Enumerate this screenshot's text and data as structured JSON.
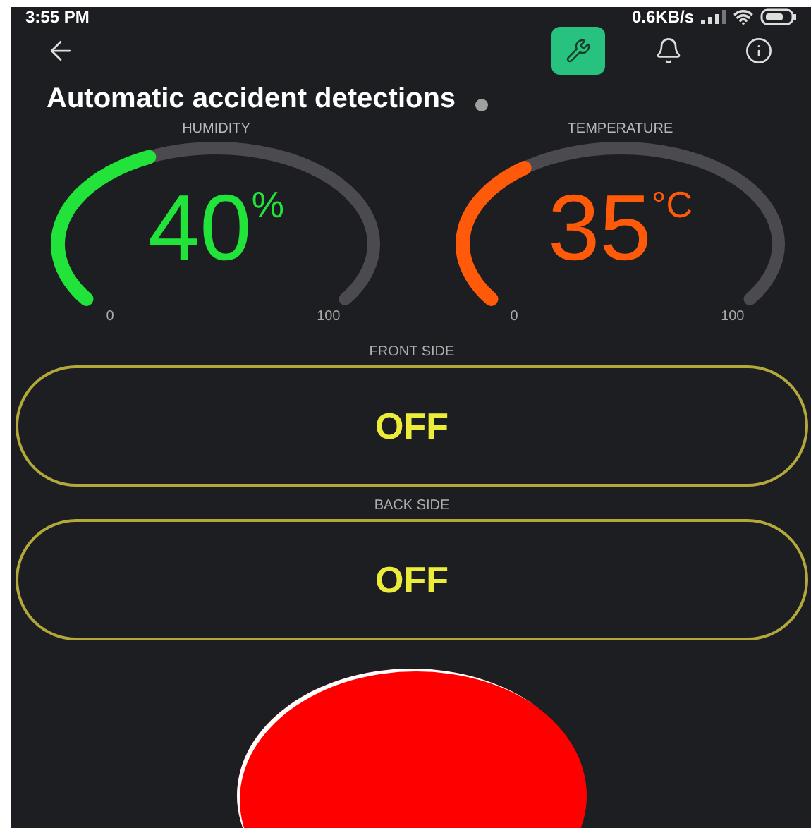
{
  "status_bar": {
    "time": "3:55 PM",
    "speed": "0.6KB/s"
  },
  "toolbar": {
    "buttons": [
      {
        "kind": "wrench",
        "selected": true
      },
      {
        "kind": "bell",
        "selected": false
      },
      {
        "kind": "info",
        "selected": false
      }
    ]
  },
  "title": "Automatic accident detections",
  "gauges": [
    {
      "label": "HUMIDITY",
      "value": "40",
      "unit": "%",
      "min": "0",
      "max": "100",
      "color": "#22e33a"
    },
    {
      "label": "TEMPERATURE",
      "value": "35",
      "unit": "°C",
      "min": "0",
      "max": "100",
      "color": "#ff5a0a"
    }
  ],
  "switches": [
    {
      "label": "FRONT SIDE",
      "state": "OFF",
      "on": false
    },
    {
      "label": "BACK SIDE",
      "state": "OFF",
      "on": false
    }
  ]
}
